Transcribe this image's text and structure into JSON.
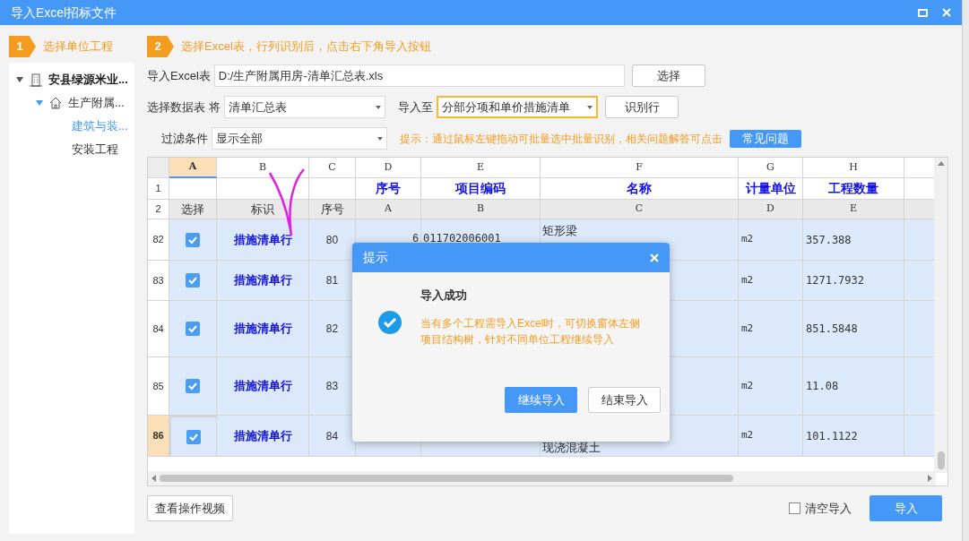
{
  "window": {
    "title": "导入Excel招标文件"
  },
  "steps": [
    {
      "number": "1",
      "label": "选择单位工程"
    },
    {
      "number": "2",
      "label": "选择Excel表，行列识别后，点击右下角导入按钮"
    }
  ],
  "tree": [
    {
      "label": "安县绿源米业...",
      "expanded": true,
      "children": [
        {
          "label": "生产附属...",
          "expanded": true,
          "children": [
            {
              "label": "建筑与装...",
              "selected": true
            },
            {
              "label": "安装工程",
              "selected": false
            }
          ]
        }
      ]
    }
  ],
  "form": {
    "excel_label": "导入Excel表",
    "excel_value": "D:/生产附属用房-清单汇总表.xls",
    "choose_button": "选择",
    "sheet_label": "选择数据表",
    "sheet_connector": "将",
    "sheet_value": "清单汇总表",
    "import_to_label": "导入至",
    "import_to_value": "分部分项和单价措施清单",
    "identify_button": "识别行",
    "filter_label": "过滤条件",
    "filter_value": "显示全部",
    "hint": "提示：通过鼠标左键拖动可批量选中批量识别，相关问题解答可点击",
    "faq_button": "常见问题"
  },
  "table": {
    "columns": [
      {
        "letter": "A",
        "selected": true
      },
      {
        "letter": "B",
        "selected": false
      },
      {
        "letter": "C",
        "selected": false
      },
      {
        "letter": "D",
        "selected": false
      },
      {
        "letter": "E",
        "selected": false
      },
      {
        "letter": "F",
        "selected": false
      },
      {
        "letter": "G",
        "selected": false
      },
      {
        "letter": "H",
        "selected": false
      }
    ],
    "header_rows": [
      {
        "number": "1",
        "cells": [
          "",
          "",
          "",
          "序号",
          "项目编码",
          "名称",
          "计量单位",
          "工程数量"
        ]
      },
      {
        "number": "2",
        "cells": [
          "选择",
          "标识",
          "序号",
          "A",
          "B",
          "C",
          "D",
          "E"
        ]
      }
    ],
    "rows": [
      {
        "number": "82",
        "selected": false,
        "checked": true,
        "mark": "措施清单行",
        "seq": "80",
        "col_d": "6",
        "col_e": "011702006001",
        "name": "矩形梁",
        "unit": "m2",
        "quantity": "357.388"
      },
      {
        "number": "83",
        "selected": false,
        "checked": true,
        "mark": "措施清单行",
        "seq": "81",
        "unit": "m2",
        "quantity": "1271.7932"
      },
      {
        "number": "84",
        "selected": false,
        "checked": true,
        "mark": "措施清单行",
        "seq": "82",
        "unit": "m2",
        "quantity": "851.5848"
      },
      {
        "number": "85",
        "selected": false,
        "checked": true,
        "mark": "措施清单行",
        "seq": "83",
        "unit": "m2",
        "quantity": "11.08"
      },
      {
        "number": "86",
        "selected": true,
        "checked": true,
        "mark": "措施清单行",
        "seq": "84",
        "name": "现浇混凝土",
        "unit": "m2",
        "quantity": "101.1122"
      }
    ]
  },
  "dialog": {
    "title": "提示",
    "heading": "导入成功",
    "message": "当有多个工程需导入Excel时，可切换窗体左侧项目结构树，针对不同单位工程继续导入",
    "buttons": [
      {
        "label": "继续导入",
        "kind": "primary"
      },
      {
        "label": "结束导入",
        "kind": "secondary"
      }
    ]
  },
  "footer": {
    "video_button": "查看操作视频",
    "clear_import": {
      "label": "清空导入",
      "checked": false
    },
    "import_button": "导入"
  }
}
